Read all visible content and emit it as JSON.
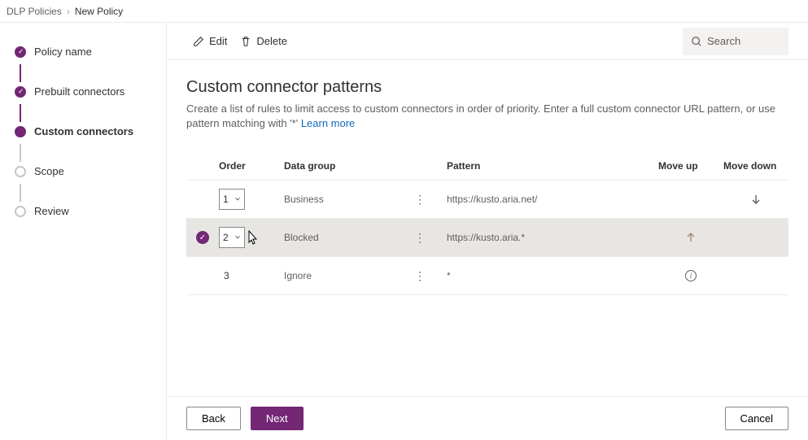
{
  "breadcrumb": {
    "parent": "DLP Policies",
    "current": "New Policy"
  },
  "steps": [
    {
      "label": "Policy name",
      "state": "done"
    },
    {
      "label": "Prebuilt connectors",
      "state": "done"
    },
    {
      "label": "Custom connectors",
      "state": "active"
    },
    {
      "label": "Scope",
      "state": "pending"
    },
    {
      "label": "Review",
      "state": "pending"
    }
  ],
  "toolbar": {
    "edit": "Edit",
    "delete": "Delete"
  },
  "search": {
    "placeholder": "Search"
  },
  "page": {
    "title": "Custom connector patterns",
    "description": "Create a list of rules to limit access to custom connectors in order of priority. Enter a full custom connector URL pattern, or use pattern matching with '*' ",
    "learn_more": "Learn more"
  },
  "columns": {
    "order": "Order",
    "data_group": "Data group",
    "pattern": "Pattern",
    "move_up": "Move up",
    "move_down": "Move down"
  },
  "rows": [
    {
      "order": "1",
      "group": "Business",
      "pattern": "https://kusto.aria.net/",
      "selected": false,
      "dropdown": true,
      "move_up": false,
      "move_down": true,
      "info": false
    },
    {
      "order": "2",
      "group": "Blocked",
      "pattern": "https://kusto.aria.*",
      "selected": true,
      "dropdown": true,
      "move_up": true,
      "move_down": false,
      "info": false
    },
    {
      "order": "3",
      "group": "Ignore",
      "pattern": "*",
      "selected": false,
      "dropdown": false,
      "move_up": false,
      "move_down": false,
      "info": true
    }
  ],
  "footer": {
    "back": "Back",
    "next": "Next",
    "cancel": "Cancel"
  }
}
